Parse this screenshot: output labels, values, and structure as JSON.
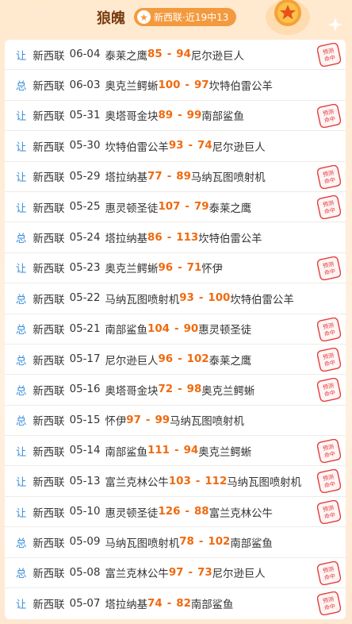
{
  "header": {
    "team_name": "狼魄",
    "badge_text": "新西联·近19中13"
  },
  "colors": {
    "accent": "#f06a0e",
    "tag": "#3b8fd8",
    "stamp": "#e53b3b"
  },
  "stamp_text": "预测命中",
  "rows": [
    {
      "tag": "让",
      "league": "新西联",
      "date": "06-04",
      "home": "泰莱之鹰",
      "home_score": "85",
      "away_score": "94",
      "away": "尼尔逊巨人",
      "hit": true
    },
    {
      "tag": "总",
      "league": "新西联",
      "date": "06-03",
      "home": "奥克兰鳄蜥",
      "home_score": "100",
      "away_score": "97",
      "away": "坎特伯雷公羊",
      "hit": false
    },
    {
      "tag": "让",
      "league": "新西联",
      "date": "05-31",
      "home": "奥塔哥金块",
      "home_score": "89",
      "away_score": "99",
      "away": "南部鲨鱼",
      "hit": true
    },
    {
      "tag": "让",
      "league": "新西联",
      "date": "05-30",
      "home": "坎特伯雷公羊",
      "home_score": "93",
      "away_score": "74",
      "away": "尼尔逊巨人",
      "hit": false
    },
    {
      "tag": "让",
      "league": "新西联",
      "date": "05-29",
      "home": "塔拉纳基",
      "home_score": "77",
      "away_score": "89",
      "away": "马纳瓦图喷射机",
      "hit": true
    },
    {
      "tag": "让",
      "league": "新西联",
      "date": "05-25",
      "home": "惠灵顿圣徒",
      "home_score": "107",
      "away_score": "79",
      "away": "泰莱之鹰",
      "hit": true
    },
    {
      "tag": "总",
      "league": "新西联",
      "date": "05-24",
      "home": "塔拉纳基",
      "home_score": "86",
      "away_score": "113",
      "away": "坎特伯雷公羊",
      "hit": false
    },
    {
      "tag": "让",
      "league": "新西联",
      "date": "05-23",
      "home": "奥克兰鳄蜥",
      "home_score": "96",
      "away_score": "71",
      "away": "怀伊",
      "hit": true
    },
    {
      "tag": "总",
      "league": "新西联",
      "date": "05-22",
      "home": "马纳瓦图喷射机",
      "home_score": "93",
      "away_score": "100",
      "away": "坎特伯雷公羊",
      "hit": false
    },
    {
      "tag": "总",
      "league": "新西联",
      "date": "05-21",
      "home": "南部鲨鱼",
      "home_score": "104",
      "away_score": "90",
      "away": "惠灵顿圣徒",
      "hit": true
    },
    {
      "tag": "总",
      "league": "新西联",
      "date": "05-17",
      "home": "尼尔逊巨人",
      "home_score": "96",
      "away_score": "102",
      "away": "泰莱之鹰",
      "hit": true
    },
    {
      "tag": "总",
      "league": "新西联",
      "date": "05-16",
      "home": "奥塔哥金块",
      "home_score": "72",
      "away_score": "98",
      "away": "奥克兰鳄蜥",
      "hit": true
    },
    {
      "tag": "总",
      "league": "新西联",
      "date": "05-15",
      "home": "怀伊",
      "home_score": "97",
      "away_score": "99",
      "away": "马纳瓦图喷射机",
      "hit": false
    },
    {
      "tag": "让",
      "league": "新西联",
      "date": "05-14",
      "home": "南部鲨鱼",
      "home_score": "111",
      "away_score": "94",
      "away": "奥克兰鳄蜥",
      "hit": true
    },
    {
      "tag": "让",
      "league": "新西联",
      "date": "05-13",
      "home": "富兰克林公牛",
      "home_score": "103",
      "away_score": "112",
      "away": "马纳瓦图喷射机",
      "hit": true
    },
    {
      "tag": "让",
      "league": "新西联",
      "date": "05-10",
      "home": "惠灵顿圣徒",
      "home_score": "126",
      "away_score": "88",
      "away": "富兰克林公牛",
      "hit": true
    },
    {
      "tag": "总",
      "league": "新西联",
      "date": "05-09",
      "home": "马纳瓦图喷射机",
      "home_score": "78",
      "away_score": "102",
      "away": "南部鲨鱼",
      "hit": false
    },
    {
      "tag": "总",
      "league": "新西联",
      "date": "05-08",
      "home": "富兰克林公牛",
      "home_score": "97",
      "away_score": "73",
      "away": "尼尔逊巨人",
      "hit": true
    },
    {
      "tag": "让",
      "league": "新西联",
      "date": "05-07",
      "home": "塔拉纳基",
      "home_score": "74",
      "away_score": "82",
      "away": "南部鲨鱼",
      "hit": true
    }
  ]
}
